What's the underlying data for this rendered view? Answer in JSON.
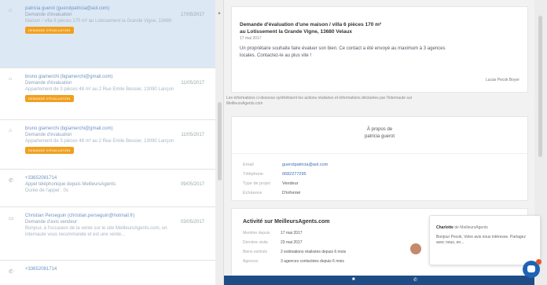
{
  "list": {
    "items": [
      {
        "name": "patricia guerot (guerotpatricia@aol.com)",
        "type": "Demande d'évaluation",
        "date": "17/05/2017",
        "text": "Maison / villa 6 pièces 170 m² au Lotissement la Grande Vigne, 13680",
        "badge": "DEMANDE D'ÉVALUATION",
        "icon": "home-icon"
      },
      {
        "name": "bruno giamerchi (bgiamerchi@gmail.com)",
        "type": "Demande d'évaluation",
        "date": "11/05/2017",
        "text": "Appartement de 3 pièces 48 m² au 2 Rue Emile Bessier, 13090 Lançon",
        "badge": "DEMANDE D'ÉVALUATION",
        "icon": "home-icon"
      },
      {
        "name": "bruno giamerchi (bgiamerchi@gmail.com)",
        "type": "Demande d'évaluation",
        "date": "11/05/2017",
        "text": "Appartement de 3 pièces 48 m² au 2 Rue Emile Bessier, 13090 Lançon",
        "badge": "DEMANDE D'ÉVALUATION",
        "icon": "home-icon"
      },
      {
        "name": "+33652081714",
        "type": "Appel téléphonique depuis MeilleursAgents",
        "date": "09/05/2017",
        "text": "Durée de l'appel : 0s",
        "badge": "",
        "icon": "phone-icon"
      },
      {
        "name": "Christian Perseguin (christian.perseguin@hotmail.fr)",
        "type": "Demande d'avis vendeur",
        "date": "03/05/2017",
        "text": "Bonjour, à l'occasion de la vente sur le site MeilleursAgents.com, un",
        "text2": "internaute vous recommande et est une vente...",
        "badge": "",
        "icon": "chat-icon"
      },
      {
        "name": "+33652081714",
        "type": "",
        "date": "",
        "text": "",
        "badge": "",
        "icon": "phone-icon"
      }
    ]
  },
  "detail": {
    "title_line1": "Demande d'évaluation d'une maison / villa 6 pièces 170 m²",
    "title_line2": "au Lotissement la Grande Vigne, 13680 Velaux",
    "date": "17 mai 2017",
    "body_line1": "Un propriétaire souhaite faire évaluer son bien. Ce contact a été envoyé au maximum à 3 agences",
    "body_line2": "locales. Contactez-le au plus vite !",
    "signature": "Lucas Pecok Boyer",
    "info_line1": "Les informations ci-dessous synthétisent les actions réalisées et informations déclarées par l'internaute sur",
    "info_line2": "MeilleursAgents.com",
    "about_line1": "À propos de",
    "about_line2": "patricia guerot",
    "contact": [
      {
        "k": "Email",
        "v": "guerotpatricia@aol.com",
        "link": true
      },
      {
        "k": "Téléphone",
        "v": "0682277295",
        "link": true
      },
      {
        "k": "Type de projet",
        "v": "Vendeur",
        "link": false
      },
      {
        "k": "Échéance",
        "v": "D'informé",
        "link": false
      }
    ],
    "activity_title": "Activité sur MeilleursAgents.com",
    "activity": [
      {
        "k": "Membre depuis",
        "v": "17 mai 2017"
      },
      {
        "k": "Dernière visite",
        "v": "23 mai 2017"
      },
      {
        "k": "Biens estimés",
        "v": "2 estimations réalisées depuis 6 mois"
      },
      {
        "k": "Agences",
        "v": "3 agences contactées depuis 6 mois"
      }
    ]
  },
  "chat": {
    "name": "Charlotte",
    "org": "de MeilleursAgents",
    "message": "Bonjour Pecok, Votre avis nous intéresse. Partagez avec nous, en..."
  },
  "colors": {
    "brand": "#1e4c86",
    "badge": "#f0a020",
    "link": "#3b6fb6"
  }
}
